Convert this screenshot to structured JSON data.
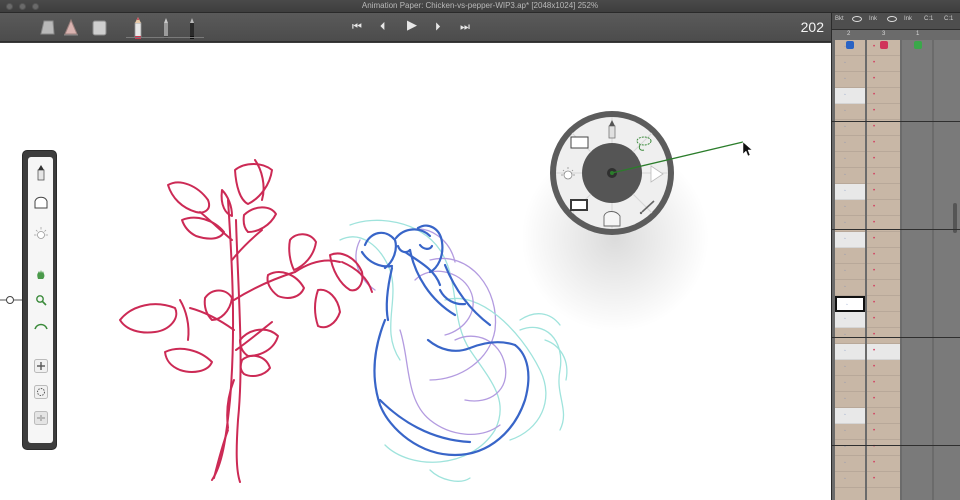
{
  "window": {
    "title": "Animation Paper: Chicken-vs-pepper-WIP3.ap* [2048x1024] 252%"
  },
  "toolbar": {
    "tools": [
      "eraser-block-tool",
      "eraser-wedge-tool",
      "eraser-soft-tool",
      "pencil-red-tool",
      "pencil-gray-tool",
      "pencil-black-tool"
    ],
    "transport": {
      "first": "⏮",
      "prev": "⏴",
      "play": "▶",
      "next": "⏵",
      "last": "⏭"
    },
    "frame_number": "202"
  },
  "palette": {
    "items": [
      "pencil-icon",
      "eraser-icon",
      "lightbulb-icon",
      "hand-icon",
      "zoom-icon",
      "rotate-icon",
      "add-icon",
      "dotted-circle-icon",
      "frame-icon"
    ]
  },
  "radial_menu": {
    "items": [
      "pencil-icon",
      "lasso-icon",
      "play-icon",
      "line-tool-icon",
      "eraser-icon",
      "paper-icon",
      "lightbulb-icon",
      "frame-icon"
    ],
    "center": "gear-icon"
  },
  "xsheet": {
    "header_labels": [
      "Bkt",
      "Ink",
      "Ink",
      "C:1",
      "C:1"
    ],
    "column_numbers": [
      "2",
      "3",
      "1"
    ],
    "layer_colors": [
      "#2a63c4",
      "#d0345a",
      "#3aa84a"
    ]
  },
  "colors": {
    "pepper": "#cc2a55",
    "chicken_blue": "#3865c8",
    "onion_purple": "#b39be0",
    "onion_cyan": "#9fe3dc",
    "menu_ring": "#5c5c5c",
    "pointer_line": "#2b7d2b"
  }
}
